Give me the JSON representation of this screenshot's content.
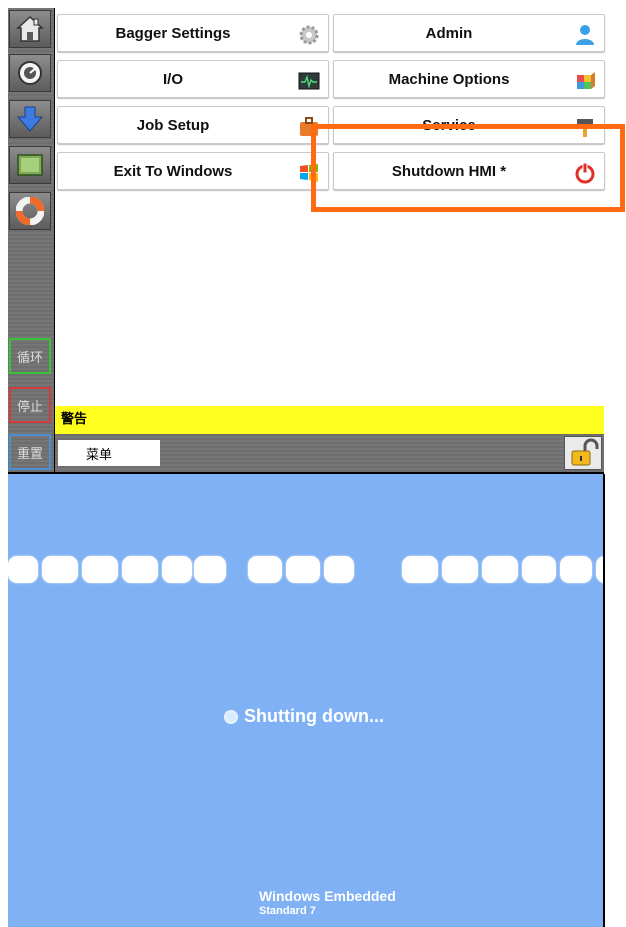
{
  "sidebar": {
    "icons": [
      "home-icon",
      "dashboard-gauge-icon",
      "download-arrow-icon",
      "screen-icon",
      "lifebuoy-icon"
    ],
    "cycle_label": "循环",
    "stop_label": "停止",
    "reset_label": "重置"
  },
  "menu": {
    "items": [
      {
        "label": "Bagger Settings",
        "icon": "gear-icon"
      },
      {
        "label": "Admin",
        "icon": "user-icon"
      },
      {
        "label": "I/O",
        "icon": "waveform-monitor-icon"
      },
      {
        "label": "Machine Options",
        "icon": "cube-icon"
      },
      {
        "label": "Job Setup",
        "icon": "briefcase-icon"
      },
      {
        "label": "Service",
        "icon": "hammer-icon"
      },
      {
        "label": "Exit To Windows",
        "icon": "windows-logo-icon"
      },
      {
        "label": "Shutdown HMI *",
        "icon": "power-icon"
      }
    ]
  },
  "warning_bar": {
    "text": "警告",
    "color": "#ffff1e"
  },
  "bottom_bar": {
    "menu_label": "菜单",
    "lock_icon": "padlock-unlocked-icon"
  },
  "highlight_color": "#ff6a13",
  "shutdown_screen": {
    "status_text": "Shutting down...",
    "brand_line1": "Windows Embedded",
    "brand_line2": "Standard 7",
    "background": "#7fb1f4"
  }
}
